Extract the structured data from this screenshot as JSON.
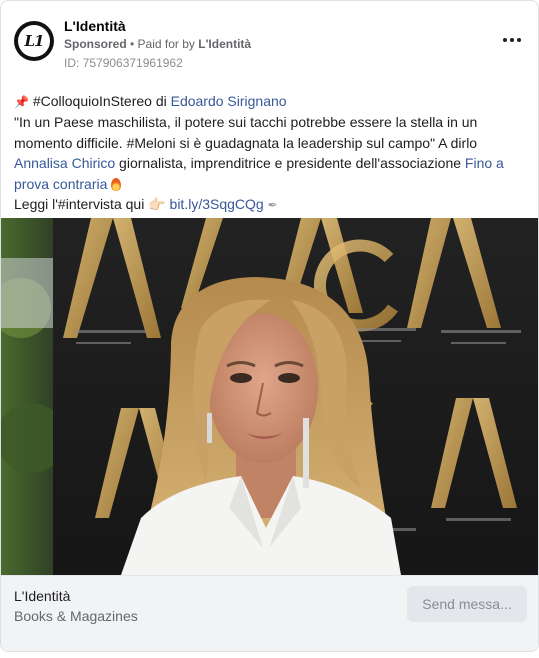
{
  "post": {
    "page_name": "L'Identità",
    "sponsored_label": "Sponsored",
    "separator": " • ",
    "paid_for_prefix": "Paid for by ",
    "paid_for_name": "L'Identità",
    "ad_id": "ID: 757906371961962",
    "avatar_text": "L1"
  },
  "body": {
    "pin_icon": "📌",
    "hashtag_intro": " #ColloquioInStereo di ",
    "author_link": "Edoardo Sirignano",
    "quote": "\"In un Paese maschilista, il potere sui tacchi potrebbe essere la stella in un momento difficile. #Meloni si è guadagnata la leadership sul campo\" A dirlo ",
    "person_link": "Annalisa Chirico",
    "person_desc": " giornalista, imprenditrice e presidente dell'associazione ",
    "assoc_link": "Fino a prova contraria",
    "read_prefix": "Leggi l'#intervista qui ",
    "hand_icon": "👉🏻",
    "short_link": "bit.ly/3SqgCQg",
    "pen_icon": "✒"
  },
  "footer": {
    "title": "L'Identità",
    "category": "Books & Magazines",
    "send_button": "Send messa..."
  },
  "colors": {
    "link": "#385898",
    "footer_bg": "#f2f3f5",
    "button_bg": "#e4e6eb"
  }
}
